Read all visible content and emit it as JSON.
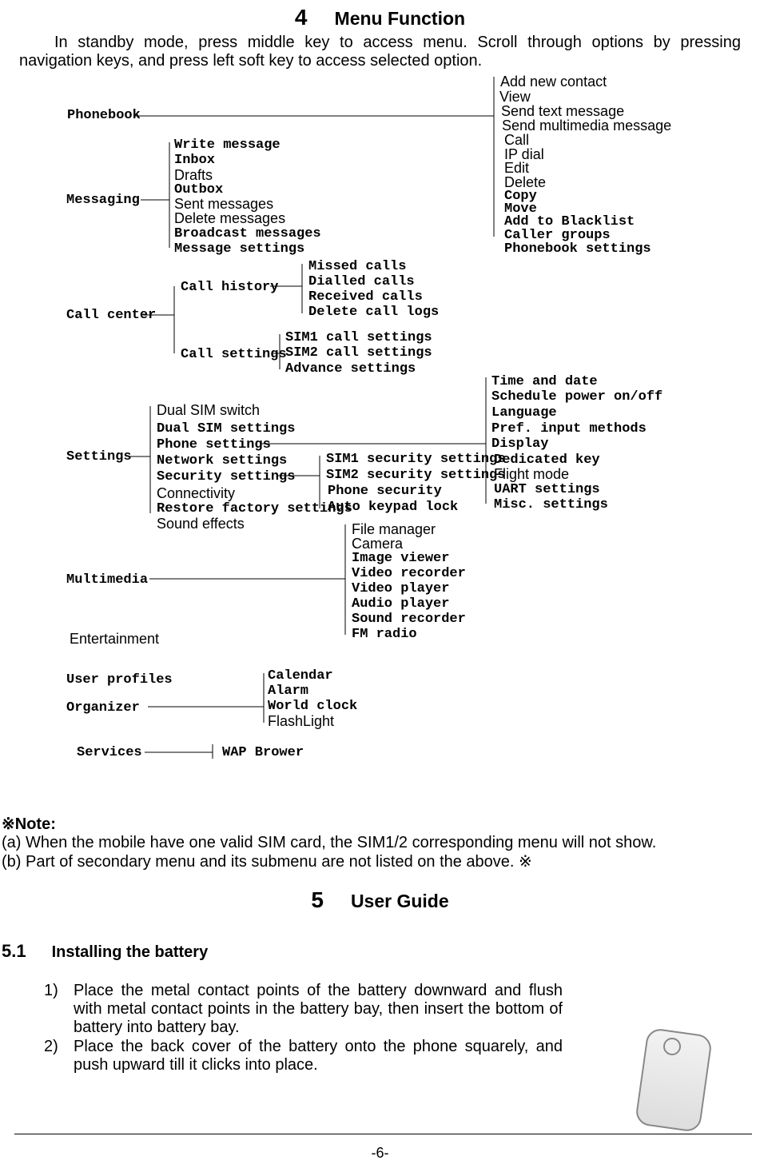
{
  "heading4": {
    "num": "4",
    "title": "Menu Function"
  },
  "introText": "In standby mode, press middle key to access menu. Scroll through options by pressing navigation keys, and press left soft key to access selected option.",
  "diagram": {
    "topMenus": {
      "phonebook": "Phonebook",
      "messaging": "Messaging",
      "callCenter": "Call center",
      "settings": "Settings",
      "multimedia": "Multimedia",
      "entertainment": "Entertainment",
      "userProfiles": "User profiles",
      "organizer": "Organizer",
      "services": "Services"
    },
    "messagingItems": {
      "writeMessage": "Write message",
      "inbox": "Inbox",
      "drafts": "Drafts",
      "outbox": "Outbox",
      "sentMessages": "Sent messages",
      "deleteMessages": "Delete messages",
      "broadcastMessages": "Broadcast messages",
      "messageSettings": "Message settings"
    },
    "callCenterItems": {
      "callHistory": "Call history",
      "callSettings": "Call settings"
    },
    "callHistoryItems": {
      "missed": "Missed calls",
      "dialled": "Dialled calls",
      "received": "Received calls",
      "deleteLogs": "Delete call logs"
    },
    "callSettingsItems": {
      "sim1": "SIM1 call settings",
      "sim2": "SIM2 call settings",
      "advance": "Advance settings"
    },
    "settingsItems": {
      "dualSimSwitch": "Dual SIM switch",
      "dualSimSettings": "Dual SIM settings",
      "phoneSettings": "Phone settings",
      "networkSettings": "Network settings",
      "securitySettings": "Security settings",
      "connectivity": "Connectivity",
      "restoreFactory": "Restore factory settings",
      "soundEffects": "Sound effects"
    },
    "phoneSettingsItems": {
      "timeDate": "Time and date",
      "schedulePower": "Schedule power on/off",
      "language": "Language",
      "prefInput": "Pref. input methods",
      "display": "Display",
      "dedicatedKey": "Dedicated key",
      "flightMode": "Flight mode",
      "uartSettings": "UART settings",
      "miscSettings": "Misc. settings"
    },
    "securitySettingsItems": {
      "sim1sec": "SIM1 security settings",
      "sim2sec": "SIM2 security settings",
      "phoneSec": "Phone security",
      "autoKeypad": "Auto keypad lock"
    },
    "multimediaItems": {
      "fileManager": "File manager",
      "camera": "Camera",
      "imageViewer": "Image viewer",
      "videoRecorder": "Video recorder",
      "videoPlayer": "Video player",
      "audioPlayer": "Audio player",
      "soundRecorder": "Sound recorder",
      "fmRadio": "FM radio"
    },
    "organizerItems": {
      "calendar": "Calendar",
      "alarm": "Alarm",
      "worldClock": "World clock",
      "flashLight": "FlashLight"
    },
    "servicesItems": {
      "wapBrowser": "WAP Brower"
    },
    "phonebookRight": {
      "addNew": "Add new contact",
      "view": "View",
      "sendText": "Send text message",
      "sendMulti": "Send multimedia message",
      "call": "Call",
      "ipDial": "IP dial",
      "edit": "Edit",
      "delete": "Delete",
      "copy": "Copy",
      "move": "Move",
      "addBlacklist": "Add to Blacklist",
      "callerGroups": "Caller groups",
      "phonebookSettings": "Phonebook settings"
    }
  },
  "note": {
    "title": "※Note:",
    "a": "(a)    When the mobile have one valid SIM card, the SIM1/2 corresponding menu will not show.",
    "b": "(b)    Part of secondary menu and its submenu are not listed on the above. ※"
  },
  "heading5": {
    "num": "5",
    "title": "User Guide"
  },
  "section51": {
    "num": "5.1",
    "title": "Installing the battery"
  },
  "steps": {
    "s1num": "1)",
    "s1": "Place the metal contact points of the battery downward and flush with metal contact points in the battery bay, then insert the bottom of battery into battery bay.",
    "s2num": "2)",
    "s2": "Place the back cover of the battery onto the phone squarely, and push upward till it clicks into place."
  },
  "pageNumber": "-6-"
}
